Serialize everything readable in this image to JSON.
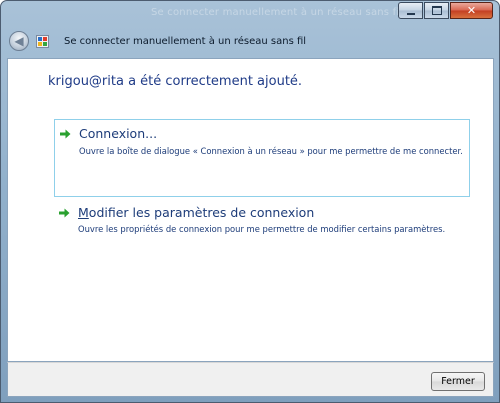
{
  "window": {
    "ghost_title": "Se connecter manuellement à un réseau sans fil"
  },
  "nav": {
    "title": "Se connecter manuellement à un réseau sans fil"
  },
  "main": {
    "heading_user": "krigou@rita",
    "heading_rest": " a été correctement ajouté."
  },
  "commands": [
    {
      "title_rest": "Connexion...",
      "description": "Ouvre la boîte de dialogue « Connexion à un réseau » pour me permettre de me connecter."
    },
    {
      "title_first": "M",
      "title_rest": "odifier les paramètres de connexion",
      "description": "Ouvre les propriétés de connexion pour me permettre de modifier certains paramètres."
    }
  ],
  "footer": {
    "close_label": "Fermer"
  },
  "colors": {
    "link_blue": "#1d3c79",
    "arrow_green": "#2aa12f",
    "focus_border": "#8fd0ea"
  },
  "icons": {
    "back": "back-arrow-icon",
    "app": "wireless-network-icon",
    "command": "green-arrow-icon"
  }
}
